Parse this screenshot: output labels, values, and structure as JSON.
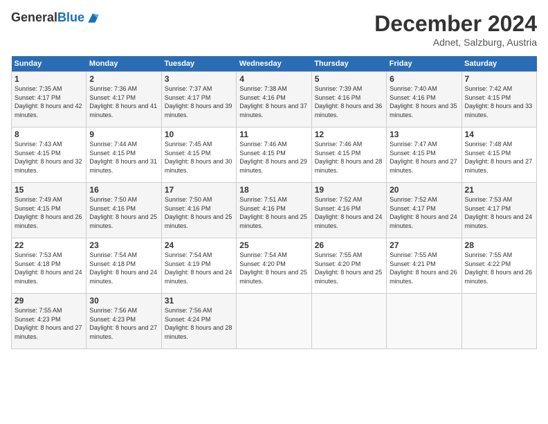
{
  "header": {
    "logo_general": "General",
    "logo_blue": "Blue",
    "month": "December 2024",
    "location": "Adnet, Salzburg, Austria"
  },
  "weekdays": [
    "Sunday",
    "Monday",
    "Tuesday",
    "Wednesday",
    "Thursday",
    "Friday",
    "Saturday"
  ],
  "weeks": [
    [
      {
        "day": "1",
        "sunrise": "Sunrise: 7:35 AM",
        "sunset": "Sunset: 4:17 PM",
        "daylight": "Daylight: 8 hours and 42 minutes."
      },
      {
        "day": "2",
        "sunrise": "Sunrise: 7:36 AM",
        "sunset": "Sunset: 4:17 PM",
        "daylight": "Daylight: 8 hours and 41 minutes."
      },
      {
        "day": "3",
        "sunrise": "Sunrise: 7:37 AM",
        "sunset": "Sunset: 4:17 PM",
        "daylight": "Daylight: 8 hours and 39 minutes."
      },
      {
        "day": "4",
        "sunrise": "Sunrise: 7:38 AM",
        "sunset": "Sunset: 4:16 PM",
        "daylight": "Daylight: 8 hours and 37 minutes."
      },
      {
        "day": "5",
        "sunrise": "Sunrise: 7:39 AM",
        "sunset": "Sunset: 4:16 PM",
        "daylight": "Daylight: 8 hours and 36 minutes."
      },
      {
        "day": "6",
        "sunrise": "Sunrise: 7:40 AM",
        "sunset": "Sunset: 4:16 PM",
        "daylight": "Daylight: 8 hours and 35 minutes."
      },
      {
        "day": "7",
        "sunrise": "Sunrise: 7:42 AM",
        "sunset": "Sunset: 4:15 PM",
        "daylight": "Daylight: 8 hours and 33 minutes."
      }
    ],
    [
      {
        "day": "8",
        "sunrise": "Sunrise: 7:43 AM",
        "sunset": "Sunset: 4:15 PM",
        "daylight": "Daylight: 8 hours and 32 minutes."
      },
      {
        "day": "9",
        "sunrise": "Sunrise: 7:44 AM",
        "sunset": "Sunset: 4:15 PM",
        "daylight": "Daylight: 8 hours and 31 minutes."
      },
      {
        "day": "10",
        "sunrise": "Sunrise: 7:45 AM",
        "sunset": "Sunset: 4:15 PM",
        "daylight": "Daylight: 8 hours and 30 minutes."
      },
      {
        "day": "11",
        "sunrise": "Sunrise: 7:46 AM",
        "sunset": "Sunset: 4:15 PM",
        "daylight": "Daylight: 8 hours and 29 minutes."
      },
      {
        "day": "12",
        "sunrise": "Sunrise: 7:46 AM",
        "sunset": "Sunset: 4:15 PM",
        "daylight": "Daylight: 8 hours and 28 minutes."
      },
      {
        "day": "13",
        "sunrise": "Sunrise: 7:47 AM",
        "sunset": "Sunset: 4:15 PM",
        "daylight": "Daylight: 8 hours and 27 minutes."
      },
      {
        "day": "14",
        "sunrise": "Sunrise: 7:48 AM",
        "sunset": "Sunset: 4:15 PM",
        "daylight": "Daylight: 8 hours and 27 minutes."
      }
    ],
    [
      {
        "day": "15",
        "sunrise": "Sunrise: 7:49 AM",
        "sunset": "Sunset: 4:15 PM",
        "daylight": "Daylight: 8 hours and 26 minutes."
      },
      {
        "day": "16",
        "sunrise": "Sunrise: 7:50 AM",
        "sunset": "Sunset: 4:16 PM",
        "daylight": "Daylight: 8 hours and 25 minutes."
      },
      {
        "day": "17",
        "sunrise": "Sunrise: 7:50 AM",
        "sunset": "Sunset: 4:16 PM",
        "daylight": "Daylight: 8 hours and 25 minutes."
      },
      {
        "day": "18",
        "sunrise": "Sunrise: 7:51 AM",
        "sunset": "Sunset: 4:16 PM",
        "daylight": "Daylight: 8 hours and 25 minutes."
      },
      {
        "day": "19",
        "sunrise": "Sunrise: 7:52 AM",
        "sunset": "Sunset: 4:16 PM",
        "daylight": "Daylight: 8 hours and 24 minutes."
      },
      {
        "day": "20",
        "sunrise": "Sunrise: 7:52 AM",
        "sunset": "Sunset: 4:17 PM",
        "daylight": "Daylight: 8 hours and 24 minutes."
      },
      {
        "day": "21",
        "sunrise": "Sunrise: 7:53 AM",
        "sunset": "Sunset: 4:17 PM",
        "daylight": "Daylight: 8 hours and 24 minutes."
      }
    ],
    [
      {
        "day": "22",
        "sunrise": "Sunrise: 7:53 AM",
        "sunset": "Sunset: 4:18 PM",
        "daylight": "Daylight: 8 hours and 24 minutes."
      },
      {
        "day": "23",
        "sunrise": "Sunrise: 7:54 AM",
        "sunset": "Sunset: 4:18 PM",
        "daylight": "Daylight: 8 hours and 24 minutes."
      },
      {
        "day": "24",
        "sunrise": "Sunrise: 7:54 AM",
        "sunset": "Sunset: 4:19 PM",
        "daylight": "Daylight: 8 hours and 24 minutes."
      },
      {
        "day": "25",
        "sunrise": "Sunrise: 7:54 AM",
        "sunset": "Sunset: 4:20 PM",
        "daylight": "Daylight: 8 hours and 25 minutes."
      },
      {
        "day": "26",
        "sunrise": "Sunrise: 7:55 AM",
        "sunset": "Sunset: 4:20 PM",
        "daylight": "Daylight: 8 hours and 25 minutes."
      },
      {
        "day": "27",
        "sunrise": "Sunrise: 7:55 AM",
        "sunset": "Sunset: 4:21 PM",
        "daylight": "Daylight: 8 hours and 26 minutes."
      },
      {
        "day": "28",
        "sunrise": "Sunrise: 7:55 AM",
        "sunset": "Sunset: 4:22 PM",
        "daylight": "Daylight: 8 hours and 26 minutes."
      }
    ],
    [
      {
        "day": "29",
        "sunrise": "Sunrise: 7:55 AM",
        "sunset": "Sunset: 4:23 PM",
        "daylight": "Daylight: 8 hours and 27 minutes."
      },
      {
        "day": "30",
        "sunrise": "Sunrise: 7:56 AM",
        "sunset": "Sunset: 4:23 PM",
        "daylight": "Daylight: 8 hours and 27 minutes."
      },
      {
        "day": "31",
        "sunrise": "Sunrise: 7:56 AM",
        "sunset": "Sunset: 4:24 PM",
        "daylight": "Daylight: 8 hours and 28 minutes."
      },
      null,
      null,
      null,
      null
    ]
  ]
}
